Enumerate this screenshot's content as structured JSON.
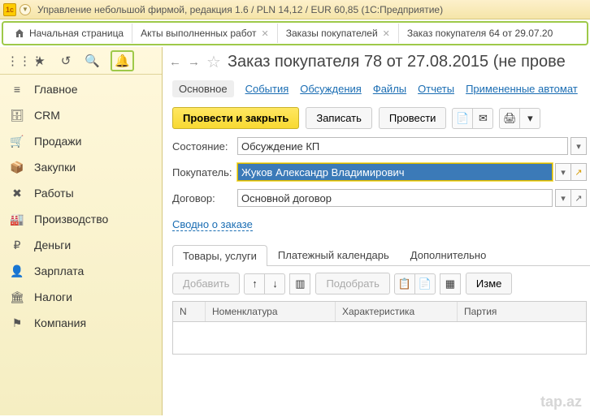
{
  "window": {
    "title": "Управление небольшой фирмой, редакция 1.6 / PLN 14,12 / EUR 60,85 (1С:Предприятие)"
  },
  "tabs": {
    "home": "Начальная страница",
    "t1": "Акты выполненных работ",
    "t2": "Заказы покупателей",
    "overflow": "Заказ покупателя 64 от 29.07.20"
  },
  "sidebar": {
    "items": [
      {
        "label": "Главное",
        "icon": "≡"
      },
      {
        "label": "CRM",
        "icon": "🗄"
      },
      {
        "label": "Продажи",
        "icon": "🛒"
      },
      {
        "label": "Закупки",
        "icon": "📦"
      },
      {
        "label": "Работы",
        "icon": "✖"
      },
      {
        "label": "Производство",
        "icon": "🏭"
      },
      {
        "label": "Деньги",
        "icon": "₽"
      },
      {
        "label": "Зарплата",
        "icon": "👤"
      },
      {
        "label": "Налоги",
        "icon": "🏛"
      },
      {
        "label": "Компания",
        "icon": "⚑"
      }
    ]
  },
  "page": {
    "title": "Заказ покупателя 78 от 27.08.2015 (не прове",
    "links": {
      "main": "Основное",
      "events": "События",
      "discuss": "Обсуждения",
      "files": "Файлы",
      "reports": "Отчеты",
      "applied": "Примененные автомат"
    },
    "buttons": {
      "post_close": "Провести и закрыть",
      "save": "Записать",
      "post": "Провести"
    },
    "fields": {
      "state_label": "Состояние:",
      "state_value": "Обсуждение КП",
      "buyer_label": "Покупатель:",
      "buyer_value": "Жуков Александр Владимирович",
      "contract_label": "Договор:",
      "contract_value": "Основной договор"
    },
    "summary_link": "Сводно о заказе",
    "subtabs": {
      "goods": "Товары, услуги",
      "payments": "Платежный календарь",
      "extra": "Дополнительно"
    },
    "grid": {
      "add": "Добавить",
      "pick": "Подобрать",
      "change": "Изме",
      "cols": {
        "n": "N",
        "nom": "Номенклатура",
        "char": "Характеристика",
        "party": "Партия"
      }
    }
  },
  "watermark": "tap.az"
}
